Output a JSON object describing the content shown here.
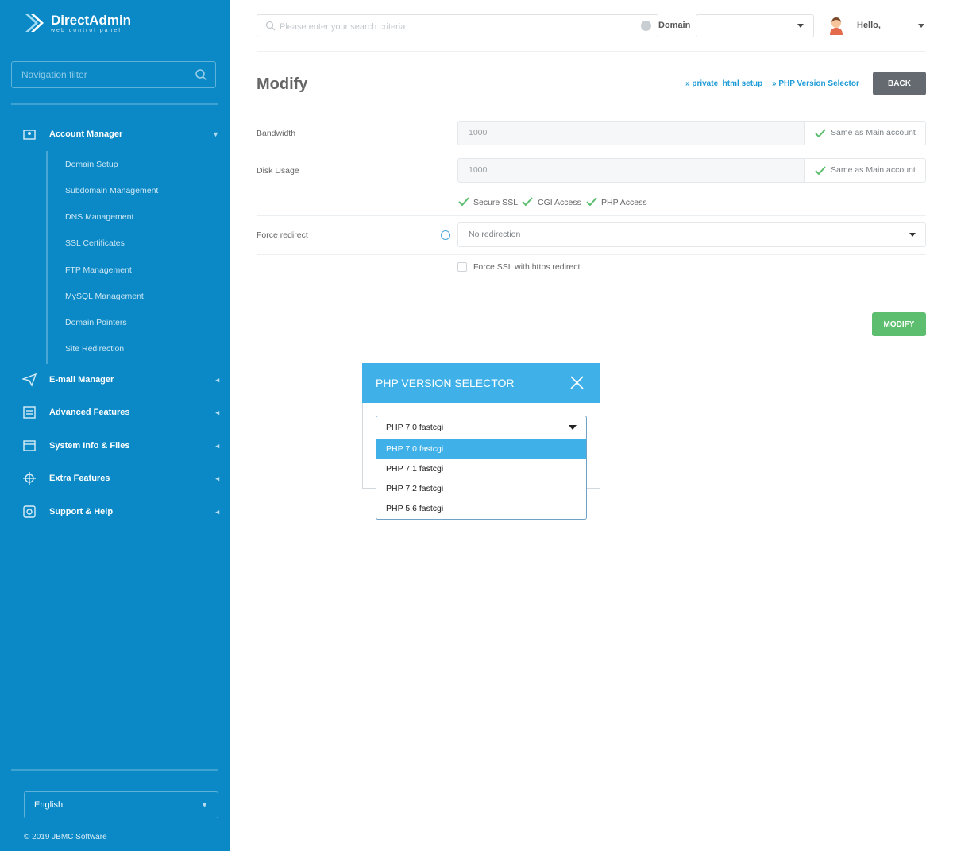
{
  "sidebar": {
    "brand": {
      "name": "DirectAdmin",
      "tagline": "web control panel"
    },
    "filter_placeholder": "Navigation filter",
    "account_manager": {
      "label": "Account Manager",
      "items": [
        "Domain Setup",
        "Subdomain Management",
        "DNS Management",
        "SSL Certificates",
        "FTP Management",
        "MySQL Management",
        "Domain Pointers",
        "Site Redirection"
      ]
    },
    "sections": [
      "E-mail Manager",
      "Advanced Features",
      "System Info & Files",
      "Extra Features",
      "Support & Help"
    ],
    "language": "English",
    "copyright": "© 2019 JBMC Software"
  },
  "topbar": {
    "search_placeholder": "Please enter your search criteria",
    "domain_label": "Domain",
    "domain_value": "",
    "hello": "Hello,"
  },
  "page": {
    "title": "Modify",
    "links": [
      "» private_html setup",
      "» PHP Version Selector"
    ],
    "back_label": "BACK",
    "bandwidth": {
      "label": "Bandwidth",
      "value": "1000",
      "same_label": "Same as Main account"
    },
    "disk": {
      "label": "Disk Usage",
      "value": "1000",
      "same_label": "Same as Main account"
    },
    "permissions": [
      "Secure SSL",
      "CGI Access",
      "PHP Access"
    ],
    "force_redirect": {
      "label": "Force redirect",
      "value": "No redirection"
    },
    "force_ssl_label": "Force SSL with https redirect",
    "modify_label": "MODIFY"
  },
  "modal": {
    "title": "PHP VERSION SELECTOR",
    "selected": "PHP 7.0 fastcgi",
    "options": [
      "PHP 7.0 fastcgi",
      "PHP 7.1 fastcgi",
      "PHP 7.2 fastcgi",
      "PHP 5.6 fastcgi"
    ]
  },
  "colors": {
    "sidebar": "#0a89c6",
    "modal_header": "#3fb1e8",
    "modify_button": "#5cbe6e",
    "back_button": "#646a6f",
    "link": "#1b9ad6"
  }
}
